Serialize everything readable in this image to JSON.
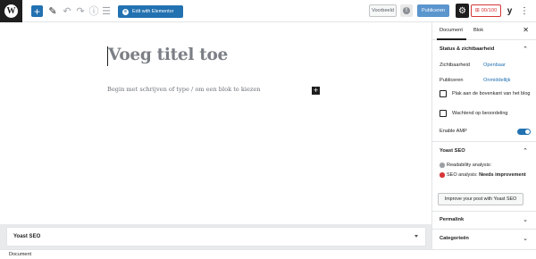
{
  "toolbar": {
    "wp_logo": "W",
    "add_icon": "+",
    "edit_icon": "✎",
    "undo_icon": "↶",
    "redo_icon": "↷",
    "info_icon": "ⓘ",
    "list_icon": "☰",
    "elementor_label": "Edit with Elementor",
    "elementor_icon": "e",
    "preview_label": "Voorbeeld",
    "circle_icon": "!",
    "publish_label": "Publiceren",
    "settings_icon": "⚙",
    "score_label": "00/100",
    "score_icon": "⊞",
    "yoast_icon": "y",
    "more_icon": "⋮",
    "accent_color": "#2271b1",
    "score_color": "#d63638"
  },
  "editor": {
    "title_placeholder": "Voeg titel toe",
    "block_placeholder": "Begin met schrijven of type / om een blok te kiezen",
    "inserter_icon": "+"
  },
  "metabox": {
    "title": "Yoast SEO"
  },
  "footer": {
    "breadcrumb": "Document"
  },
  "sidebar": {
    "tabs": [
      {
        "label": "Document",
        "active": true
      },
      {
        "label": "Blok",
        "active": false
      }
    ],
    "close_icon": "✕",
    "status": {
      "title": "Status & zichtbaarheid",
      "visibility_label": "Zichtbaarheid",
      "visibility_value": "Openbaar",
      "publish_label": "Publiceren",
      "publish_value": "Onmiddellijk",
      "sticky_label": "Plak aan de bovenkant van het blog",
      "sticky_checked": false,
      "pending_label": "Wachtend op beoordeling",
      "pending_checked": false,
      "amp_label": "Enable AMP",
      "amp_enabled": true
    },
    "yoast": {
      "title": "Yoast SEO",
      "readability": "Readability analysis:",
      "readability_color": "#9ca0a4",
      "seo_prefix": "SEO analysis:",
      "seo_value": "Needs improvement",
      "seo_color": "#d63638",
      "improve_button": "Improve your post with Yoast SEO"
    },
    "permalink": {
      "title": "Permalink"
    },
    "categories": {
      "title": "Categorieën"
    },
    "chevron_up": "⌃",
    "chevron_down": "⌄"
  }
}
